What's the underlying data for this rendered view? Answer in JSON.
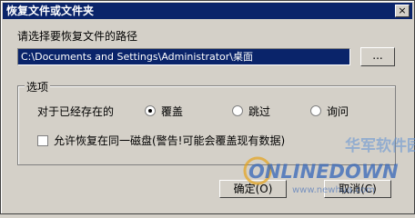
{
  "window": {
    "title": "恢复文件或文件夹",
    "close_glyph": "×"
  },
  "path": {
    "label": "请选择要恢复文件的路径",
    "value": "C:\\Documents and Settings\\Administrator\\桌面",
    "browse_label": "..."
  },
  "options": {
    "group_label": "选项",
    "existing_label": "对于已经存在的",
    "radios": [
      {
        "label": "覆盖",
        "checked": true
      },
      {
        "label": "跳过",
        "checked": false
      },
      {
        "label": "询问",
        "checked": false
      }
    ],
    "allow_same_disk": {
      "label": "允许恢复在同一磁盘(警告!可能会覆盖现有数据)",
      "checked": false
    }
  },
  "buttons": {
    "ok": "确定(O)",
    "cancel": "取消(C)"
  },
  "watermark": {
    "cn": "华军软件园",
    "brand": "ONLINEDOWN",
    "url": "www.newhua.com"
  },
  "colors": {
    "titlebar": "#0a246a",
    "face": "#d4d0c8",
    "selection": "#0a246a"
  }
}
